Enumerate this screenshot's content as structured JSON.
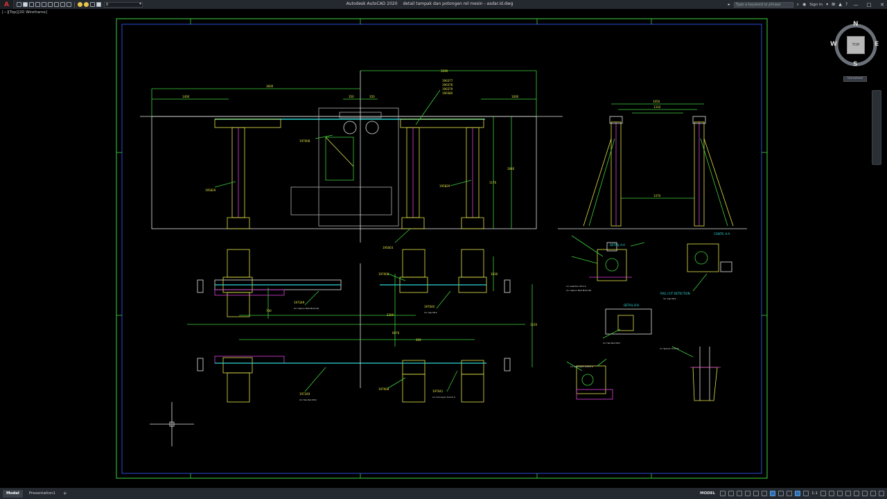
{
  "titlebar": {
    "app_button": "A",
    "layer_value": "0",
    "app_name": "Autodesk AutoCAD 2020",
    "file_name": "detail tampak dan potongan rel mesin - asdar.id.dwg",
    "search_placeholder": "Type a keyword or phrase",
    "sign_in": "Sign In"
  },
  "viewport": {
    "label": "[−][Top][2D Wireframe]"
  },
  "viewcube": {
    "north": "N",
    "south": "S",
    "east": "E",
    "west": "W",
    "face": "TOP",
    "wcs": "Unnamed"
  },
  "statusbar": {
    "tabs": [
      "Model",
      "Presentation1"
    ],
    "add_tab": "+",
    "model_space": "MODEL",
    "scale": "1:1"
  },
  "drawing": {
    "dims": [
      "3290",
      "3600",
      "1400",
      "1000",
      "350",
      "350",
      "2840",
      "1170",
      "1050",
      "1310",
      "1470",
      "700",
      "2300",
      "6070",
      "400",
      "1220",
      "1030",
      "2000",
      "6100"
    ],
    "part_labels": [
      "190377",
      "190378",
      "190379",
      "190380",
      "197008",
      "195829",
      "195829",
      "195003",
      "197349",
      "197040",
      "197008",
      "197349",
      "197041",
      "197008"
    ],
    "section_titles": [
      "DETAIL A-A",
      "DETAIL B-B",
      "CONTR. A-A",
      "RAIL CUT DETECTION"
    ],
    "notes": [
      "1× Gearbox 28 2.0",
      "2× Caplon Bolt M12×40",
      "3× Cap M12",
      "1× Conveyor Guard A",
      "2× Hex Nut M12",
      "1× Spacer 4×5×6"
    ]
  },
  "colors": {
    "accent_yellow": "#e6e64a",
    "green": "#3fd33f",
    "cyan": "#2fd6d6",
    "magenta": "#e040e0",
    "blue_frame": "#2a4bd6",
    "white": "#e6e6e6"
  }
}
